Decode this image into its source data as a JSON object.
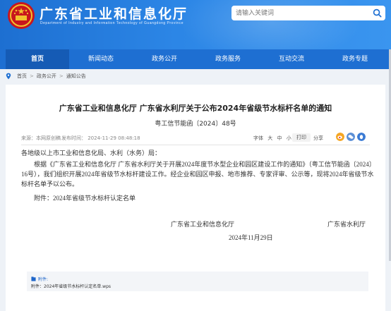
{
  "header": {
    "title": "广东省工业和信息化厅",
    "subtitle": "Department of Industry and Information Technology of Guangdong Province",
    "search_placeholder": "请输入关键词"
  },
  "nav": {
    "items": [
      {
        "label": "首页",
        "active": true
      },
      {
        "label": "新闻动态"
      },
      {
        "label": "政务公开"
      },
      {
        "label": "政务服务"
      },
      {
        "label": "互动交流"
      },
      {
        "label": "政务专题"
      }
    ]
  },
  "breadcrumb": [
    "首页",
    "政务公开",
    "通知公告"
  ],
  "article": {
    "title": "广东省工业和信息化厅 广东省水利厅关于公布2024年省级节水标杆名单的通知",
    "doc_number": "粤工信节能函〔2024〕48号",
    "source": "来源：本网原创稿",
    "publish_time": "发布时间： 2024-11-29 08:48:18",
    "font_label": "字体",
    "font_sizes": [
      "大",
      "中",
      "小"
    ],
    "print_label": "打印",
    "share_label": "分享",
    "salutation": "各地级以上市工业和信息化局、水利（水务）局：",
    "body": "根据《广东省工业和信息化厅 广东省水利厅关于开展2024年度节水型企业和园区建设工作的通知》（粤工信节能函〔2024〕16号），我们组织开展2024年省级节水标杆建设工作。经企业和园区申报、地市推荐、专家评审、公示等，现将2024年省级节水标杆名单予以公布。",
    "attachment_line": "附件：2024年省级节水标杆认定名单",
    "signer_1": "广东省工业和信息化厅",
    "signer_2": "广东省水利厅",
    "sign_date": "2024年11月29日"
  },
  "attachments": {
    "label": "附件:",
    "file": "附件：2024年省级节水标杆认定名单.wps"
  },
  "colors": {
    "header_blue": "#2c86e6",
    "nav_blue": "#1e6fd2",
    "nav_active": "#155bb5",
    "link_blue": "#1f66c9"
  }
}
